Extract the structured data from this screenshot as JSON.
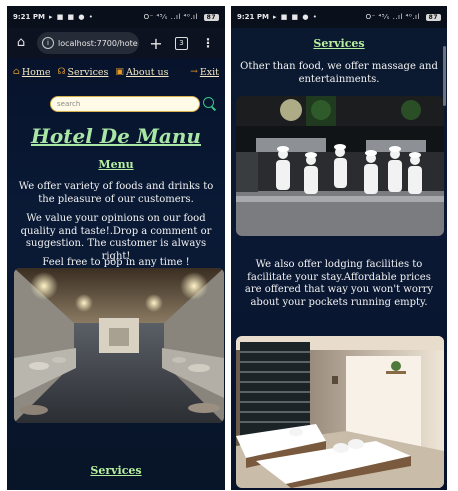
{
  "status_bar": {
    "time": "9:21 PM",
    "notification_icons": "▸ ■ ■ ● •",
    "signal_text": "O⁻ ⁴⁵⁄ₛ ..ıl ⁴⁰.ıl",
    "battery": "87"
  },
  "browser": {
    "url": "localhost:7700/hote",
    "tab_count": "3"
  },
  "nav": {
    "items": [
      {
        "label": "Home",
        "icon": "home-icon"
      },
      {
        "label": "Services",
        "icon": "headset-icon"
      },
      {
        "label": "About us",
        "icon": "id-card-icon"
      },
      {
        "label": "Exit",
        "icon": "arrow-right-icon"
      }
    ]
  },
  "search": {
    "placeholder": "search"
  },
  "left_page": {
    "title": "Hotel De Manu",
    "menu_heading": "Menu",
    "paragraph_1": "We offer variety of foods and drinks to the pleasure of our customers.",
    "paragraph_2": "We value your opinions on our food quality and taste!.Drop a comment or suggestion. The customer is always right!",
    "paragraph_3": "Feel free to pop in any time !",
    "services_heading": "Services"
  },
  "right_page": {
    "services_heading": "Services",
    "paragraph_1": "Other than food, we offer massage and entertainments.",
    "paragraph_2": "We also offer lodging facilities to facilitate your stay.Affordable prices are offered that way you won't worry about your pockets running empty."
  },
  "colors": {
    "page_bg": "#061026",
    "title_green": "#a8e6a6",
    "accent_orange": "#e59a2a",
    "search_border": "#d6b04a"
  }
}
